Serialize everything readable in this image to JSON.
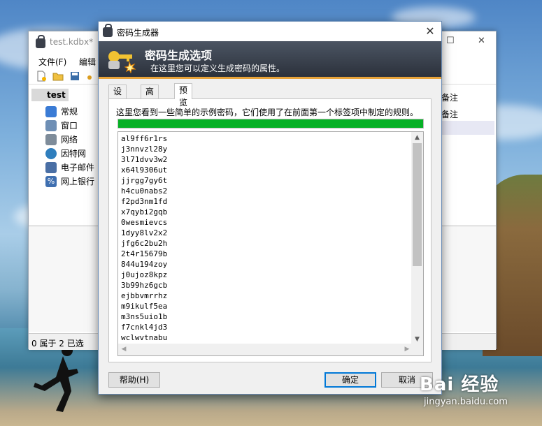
{
  "main_window": {
    "title": "test.kdbx*",
    "menu": [
      "文件(F)",
      "编辑"
    ],
    "tree": {
      "root": "test",
      "items": [
        {
          "label": "常规",
          "icon": "folder-icon",
          "color": "#3a7bd5"
        },
        {
          "label": "窗口",
          "icon": "computer-icon",
          "color": "#6e8fb5"
        },
        {
          "label": "网络",
          "icon": "network-icon",
          "color": "#7e8c9a"
        },
        {
          "label": "因特网",
          "icon": "globe-icon",
          "color": "#2f7ebd"
        },
        {
          "label": "电子邮件",
          "icon": "email-icon",
          "color": "#4a6fa5"
        },
        {
          "label": "网上银行",
          "icon": "percent-icon",
          "color": "#3f6fb0"
        }
      ]
    },
    "right_column": [
      "备注",
      "备注"
    ],
    "status": "0 属于 2 已选"
  },
  "dialog": {
    "title": "密码生成器",
    "close_symbol": "✕",
    "banner": {
      "heading": "密码生成选项",
      "subtitle": "在这里您可以定义生成密码的属性。"
    },
    "tabs": [
      {
        "label": "设置",
        "active": false
      },
      {
        "label": "高级",
        "active": false
      },
      {
        "label": "预览",
        "active": true
      }
    ],
    "preview": {
      "description": "这里您看到一些简单的示例密码，它们使用了在前面第一个标签项中制定的规则。",
      "progress_percent": 100,
      "progress_color": "#06b025",
      "passwords": [
        "al9ff6r1rs",
        "j3nnvzl28y",
        "3l71dvv3w2",
        "x64l9306ut",
        "jjrgg7gy6t",
        "h4cu0nabs2",
        "f2pd3nm1fd",
        "x7qybi2gqb",
        "0wesmievcs",
        "1dyy8lv2x2",
        "jfg6c2bu2h",
        "2t4r15679b",
        "844u194zoy",
        "j0ujoz8kpz",
        "3b99hz6gcb",
        "ejbbvmrrhz",
        "m9ikulf5ea",
        "m3ns5uio1b",
        "f7cnkl4jd3",
        "wclwvtnabu"
      ]
    },
    "buttons": {
      "help": "帮助(H)",
      "ok": "确定",
      "cancel": "取消"
    }
  },
  "watermark": {
    "logo": "Bai 经验",
    "url": "jingyan.baidu.com"
  }
}
